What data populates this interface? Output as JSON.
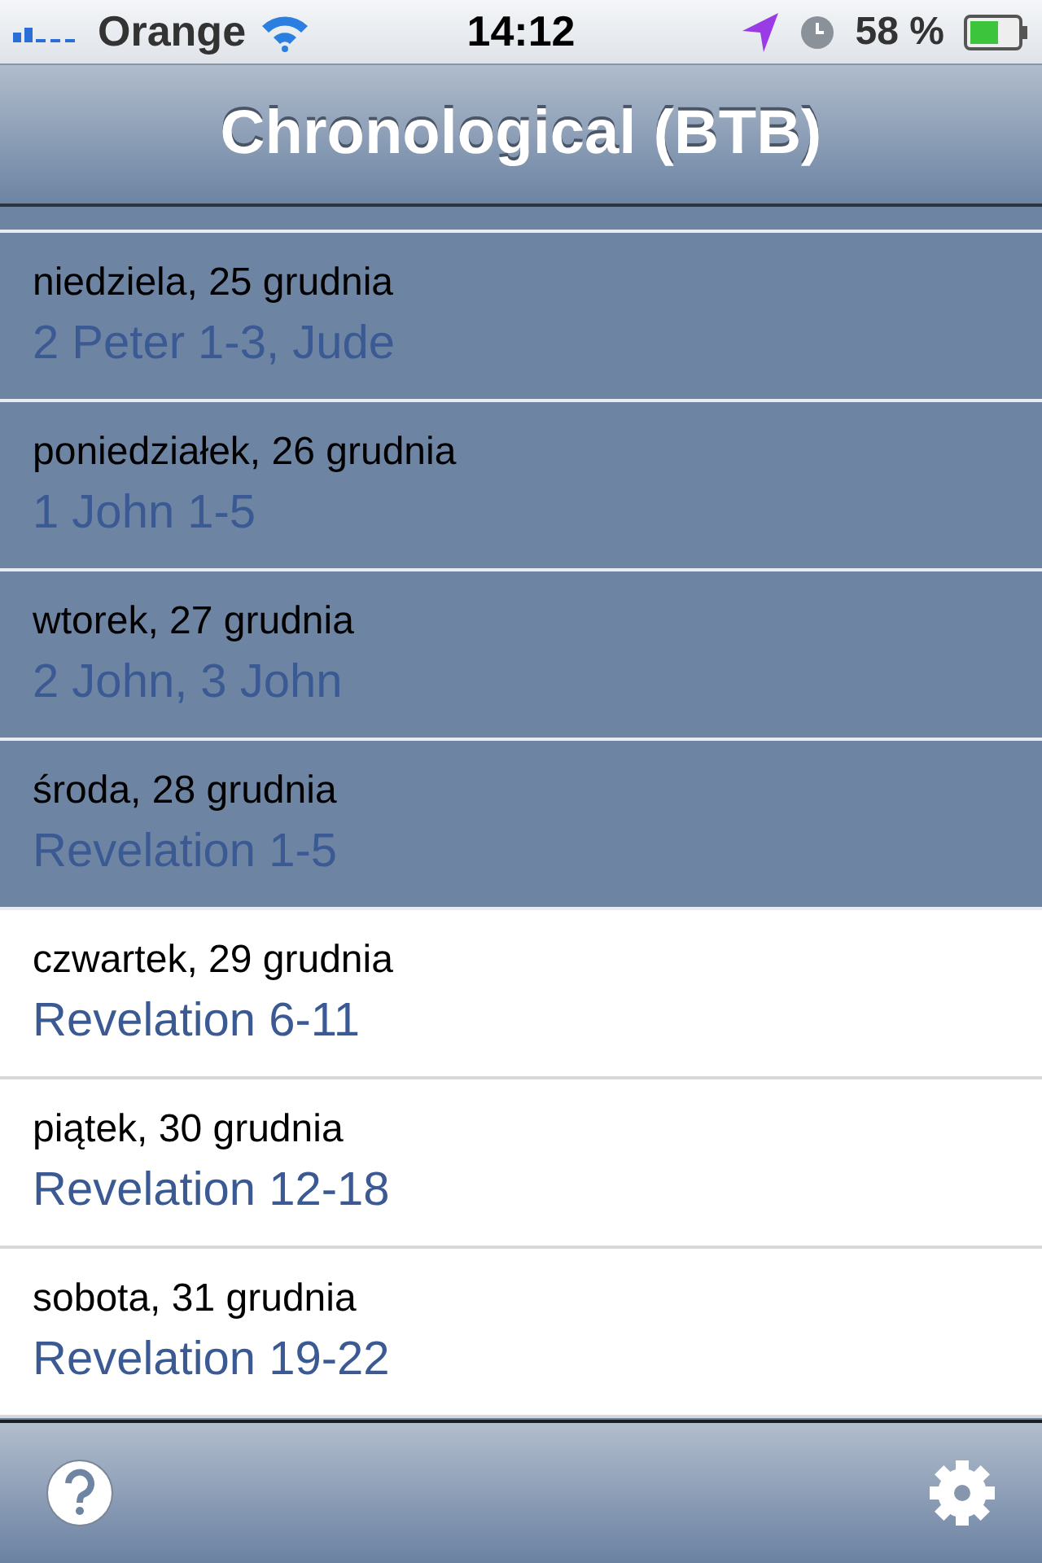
{
  "status_bar": {
    "carrier": "Orange",
    "time": "14:12",
    "battery": "58 %"
  },
  "nav_bar": {
    "title": "Chronological (BTB)"
  },
  "readings": [
    {
      "date": "niedziela, 25 grudnia",
      "passage": "2 Peter 1-3, Jude",
      "done": true
    },
    {
      "date": "poniedziałek, 26 grudnia",
      "passage": "1 John 1-5",
      "done": true
    },
    {
      "date": "wtorek, 27 grudnia",
      "passage": "2 John, 3 John",
      "done": true
    },
    {
      "date": "środa, 28 grudnia",
      "passage": "Revelation 1-5",
      "done": true
    },
    {
      "date": "czwartek, 29 grudnia",
      "passage": "Revelation 6-11",
      "done": false
    },
    {
      "date": "piątek, 30 grudnia",
      "passage": "Revelation 12-18",
      "done": false
    },
    {
      "date": "sobota, 31 grudnia",
      "passage": "Revelation 19-22",
      "done": false
    }
  ]
}
